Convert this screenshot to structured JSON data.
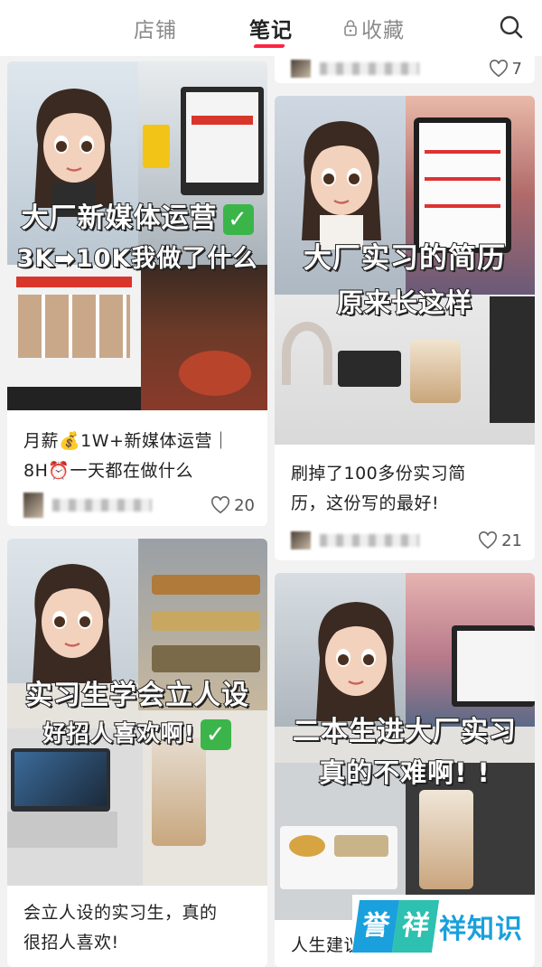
{
  "tabs": {
    "shop": "店铺",
    "notes": "笔记",
    "collect": "收藏"
  },
  "left_column": [
    {
      "cover_line1": "大厂新媒体运营",
      "cover_line2": "3K➡10K我做了什么",
      "title_line1": "月薪💰1W+新媒体运营｜",
      "title_line2": "8H⏰一天都在做什么",
      "likes": "20"
    },
    {
      "cover_line1": "实习生学会立人设",
      "cover_line2": "好招人喜欢啊!",
      "title_line1": "会立人设的实习生，真的",
      "title_line2": "很招人喜欢!"
    }
  ],
  "right_column": [
    {
      "likes": "7"
    },
    {
      "cover_line1": "大厂实习的简历",
      "cover_line2": "原来长这样",
      "title_line1": "刷掉了100多份实习简",
      "title_line2": "历，这份写的最好!",
      "likes": "21"
    },
    {
      "cover_line1": "二本生进大厂实习",
      "cover_line2": "真的不难啊! !",
      "title_line1": "人生建议"
    }
  ],
  "watermark": {
    "char1": "誉",
    "char2": "祥",
    "text": "祥知识"
  },
  "colors": {
    "accent": "#ff2442",
    "check_green": "#3bb54a"
  },
  "icons": [
    "lock-icon",
    "search-icon",
    "heart-icon",
    "check-icon"
  ]
}
